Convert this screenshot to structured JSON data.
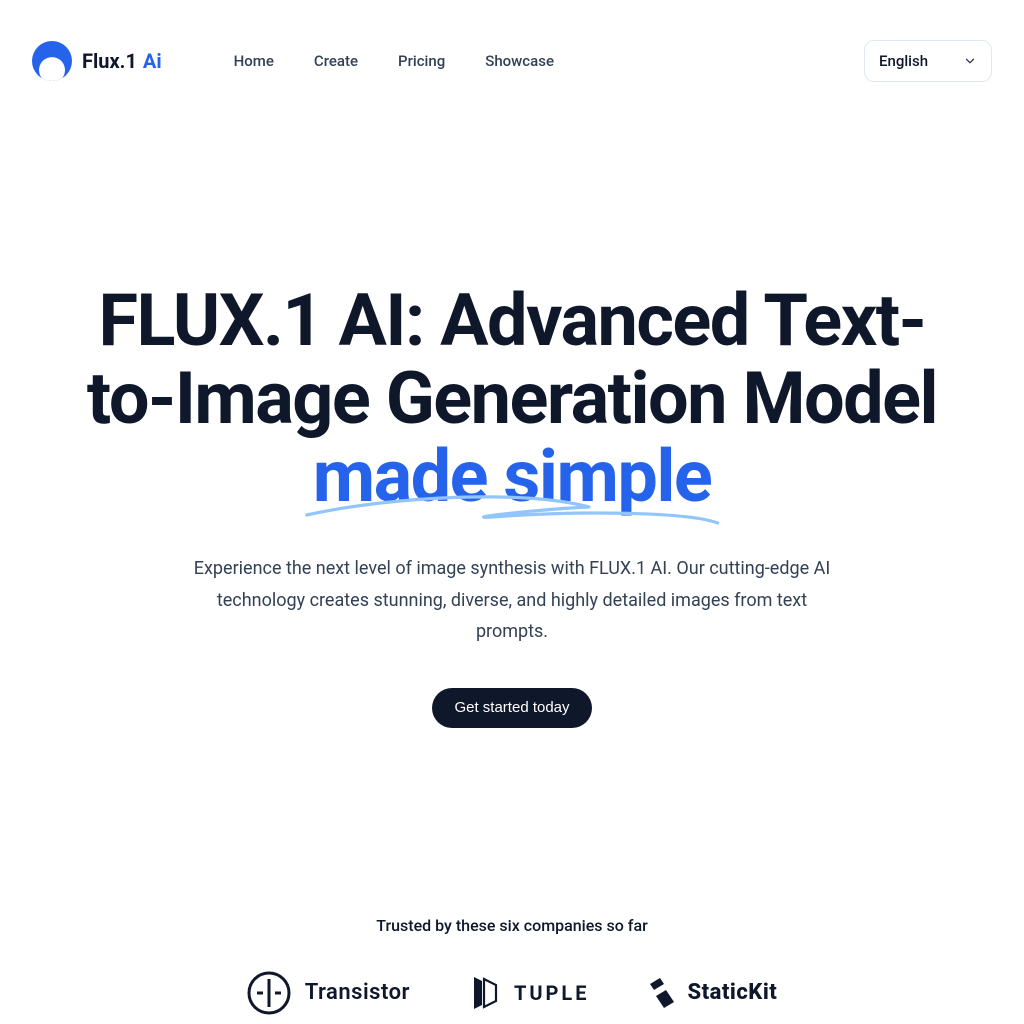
{
  "brand": {
    "name": "Flux.1",
    "suffix": "Ai"
  },
  "nav": {
    "home": "Home",
    "create": "Create",
    "pricing": "Pricing",
    "showcase": "Showcase"
  },
  "language": {
    "selected": "English"
  },
  "hero": {
    "headline_plain": "FLUX.1 AI: Advanced Text-to-Image Generation Model ",
    "headline_highlight": "made simple",
    "subcopy": "Experience the next level of image synthesis with FLUX.1 AI. Our cutting-edge AI technology creates stunning, diverse, and highly detailed images from text prompts.",
    "cta_label": "Get started today"
  },
  "trusted": {
    "label": "Trusted by these six companies so far",
    "companies": {
      "transistor": "Transistor",
      "tuple": "TUPLE",
      "statickit": "StaticKit"
    }
  },
  "colors": {
    "accent": "#2563eb",
    "ink": "#0f172a"
  }
}
